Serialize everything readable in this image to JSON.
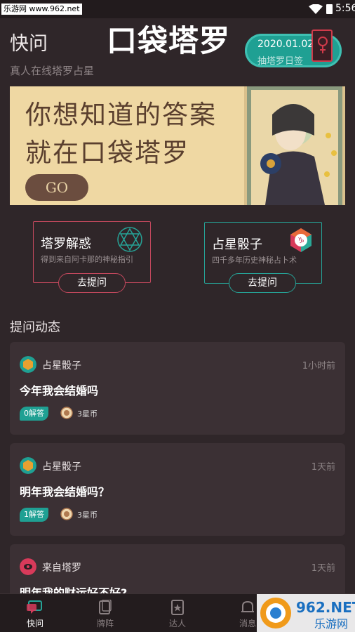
{
  "status_bar": {
    "watermark": "乐游网 www.962.net",
    "time": "5:56"
  },
  "header": {
    "title": "快问",
    "subtitle": "真人在线塔罗占星",
    "app_name": "口袋塔罗",
    "date": "2020.01.02",
    "daily_label": "抽塔罗日签"
  },
  "banner": {
    "line1": "你想知道的答案",
    "line2": "就在口袋塔罗",
    "go_label": "GO"
  },
  "features": [
    {
      "title": "塔罗解惑",
      "desc": "得到来自阿卡那的神秘指引",
      "button": "去提问",
      "icon": "hexagram-icon"
    },
    {
      "title": "占星骰子",
      "desc": "四千多年历史神秘占卜术",
      "button": "去提问",
      "icon": "zodiac-dice-icon"
    }
  ],
  "section_title": "提问动态",
  "questions": [
    {
      "source": "占星骰子",
      "time": "1小时前",
      "question": "今年我会结婚吗",
      "answers": "0解答",
      "coins": "3星币"
    },
    {
      "source": "占星骰子",
      "time": "1天前",
      "question": "明年我会结婚吗？",
      "answers": "1解答",
      "coins": "3星币"
    },
    {
      "source": "来自塔罗",
      "time": "1天前",
      "question": "明年我的财运好不好?"
    }
  ],
  "tabs": [
    {
      "label": "快问",
      "active": true
    },
    {
      "label": "牌阵",
      "active": false
    },
    {
      "label": "达人",
      "active": false
    },
    {
      "label": "消息",
      "active": false
    }
  ],
  "watermark_corner": {
    "brand": "962.NET",
    "site": "乐游网"
  },
  "colors": {
    "background": "#2f2629",
    "accent_teal": "#1fa093",
    "accent_red": "#c3485d",
    "banner": "#efd8a3"
  }
}
